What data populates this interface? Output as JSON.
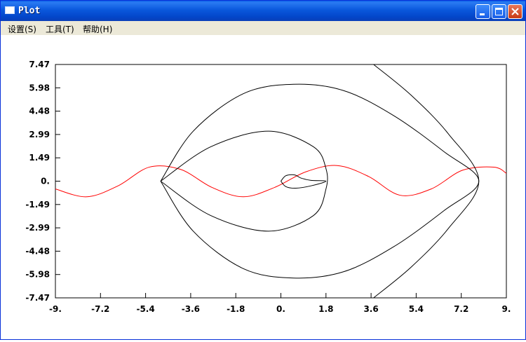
{
  "window": {
    "title": "Plot",
    "buttons": [
      "minimize",
      "maximize",
      "close"
    ]
  },
  "menu": {
    "items": [
      {
        "label": "设置(S)"
      },
      {
        "label": "工具(T)"
      },
      {
        "label": "帮助(H)"
      }
    ]
  },
  "chart_data": {
    "type": "line",
    "title": "",
    "xlabel": "",
    "ylabel": "",
    "xlim": [
      -9,
      9
    ],
    "ylim": [
      -7.47,
      7.47
    ],
    "x_ticks": [
      "-9.",
      "-7.2",
      "-5.4",
      "-3.6",
      "-1.8",
      "0.",
      "1.8",
      "3.6",
      "5.4",
      "7.2",
      "9."
    ],
    "y_ticks": [
      "7.47",
      "5.98",
      "4.48",
      "2.99",
      "1.49",
      "0.",
      "-1.49",
      "-2.99",
      "-4.48",
      "-5.98",
      "-7.47"
    ],
    "grid": false,
    "series": [
      {
        "color": "#ff0000",
        "x": [
          -9,
          -7.75,
          -6.5,
          -5.25,
          -4.0,
          -2.75,
          -1.5,
          -0.25,
          1.0,
          2.25,
          3.5,
          4.75,
          6.0,
          7.25,
          8.5,
          9
        ],
        "y": [
          -0.5,
          -1.0,
          -0.3,
          0.9,
          0.75,
          -0.4,
          -1.0,
          -0.4,
          0.6,
          1.0,
          0.3,
          -0.9,
          -0.5,
          0.7,
          0.9,
          0.5
        ]
      },
      {
        "color": "#000000",
        "x": [
          -4.8,
          -3.5,
          -1.5,
          0.5,
          2.5,
          4.5,
          6.5,
          7.9,
          6.5,
          4.5,
          2.5,
          0.5,
          -1.5,
          -3.5,
          -4.8
        ],
        "y": [
          0.0,
          3.2,
          5.6,
          6.2,
          5.8,
          4.2,
          1.9,
          0.0,
          -1.9,
          -4.2,
          -5.8,
          -6.2,
          -5.6,
          -3.2,
          0.0
        ]
      },
      {
        "color": "#000000",
        "x": [
          -4.8,
          -2.8,
          -0.5,
          1.3,
          1.8,
          1.8,
          1.3,
          -0.5,
          -2.8,
          -4.8
        ],
        "y": [
          0.0,
          2.2,
          3.2,
          2.2,
          0.8,
          -0.5,
          -2.2,
          -3.2,
          -2.2,
          0.0
        ]
      },
      {
        "color": "#000000",
        "x": [
          0.0,
          0.2,
          0.55,
          0.8,
          1.2,
          1.8,
          1.2,
          0.6,
          0.2,
          0.0
        ],
        "y": [
          0.0,
          0.35,
          0.4,
          0.2,
          0.05,
          0.0,
          -0.3,
          -0.45,
          -0.35,
          0.0
        ]
      },
      {
        "color": "#000000",
        "x": [
          3.7,
          5.2,
          6.7,
          7.9,
          6.7,
          5.2,
          3.7
        ],
        "y": [
          7.47,
          5.5,
          3.0,
          0.0,
          -3.0,
          -5.5,
          -7.47
        ]
      }
    ]
  }
}
